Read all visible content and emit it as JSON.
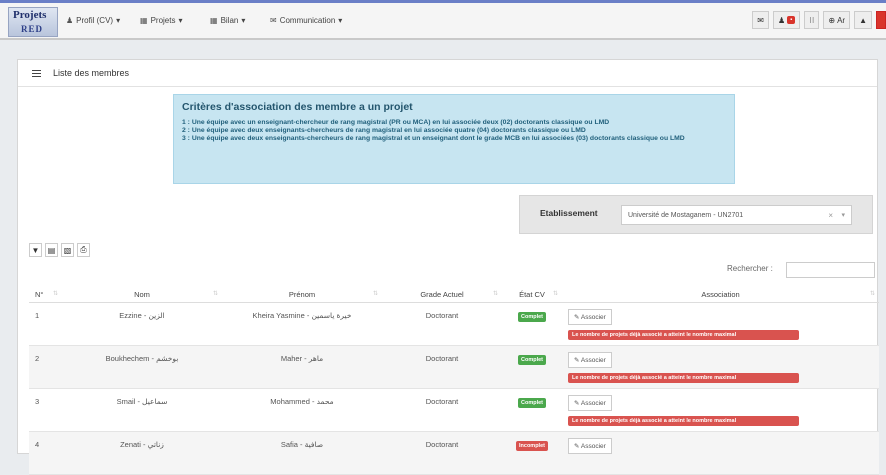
{
  "app": {
    "logo_line1": "Projets",
    "logo_line2": "RED"
  },
  "nav": [
    {
      "icon": "user-icon",
      "glyph": "♟",
      "label": "Profil (CV)",
      "caret": "▾"
    },
    {
      "icon": "table-icon",
      "glyph": "▦",
      "label": "Projets",
      "caret": "▾"
    },
    {
      "icon": "table-icon",
      "glyph": "▦",
      "label": "Bilan",
      "caret": "▾"
    },
    {
      "icon": "chat-icon",
      "glyph": "✉",
      "label": "Communication",
      "caret": "▾"
    }
  ],
  "top_right": {
    "lang": "Ar"
  },
  "panel": {
    "title": "Liste des membres"
  },
  "criteria": {
    "title": "Critères d'association des membre a un projet",
    "lines": [
      "1 : Une équipe avec un enseignant-chercheur de rang magistral (PR ou MCA) en lui associée deux (02) doctorants classique ou LMD",
      "2 : Une équipe avec deux enseignants-chercheurs de rang magistral en lui associée quatre (04) doctorants classique ou LMD",
      "3 : Une équipe avec deux enseignants-chercheurs de rang magistral et un enseignant dont le grade MCB en lui associées (03) doctorants classique ou LMD"
    ]
  },
  "etablissement": {
    "label": "Etablissement",
    "value": "Université de Mostaganem - UN2701"
  },
  "search": {
    "label": "Rechercher :"
  },
  "table": {
    "headers": [
      "N°",
      "Nom",
      "Prénom",
      "Grade Actuel",
      "État CV",
      "Association"
    ],
    "rows": [
      {
        "num": "1",
        "nom": "Ezzine - الزين",
        "prenom": "Kheira Yasmine - خيرة ياسمين",
        "grade": "Doctorant",
        "cv": "Complet",
        "cv_status": "ok",
        "btn": "✎ Associer",
        "warn": "Le nombre de projets déjà associé a atteint le nombre maximal"
      },
      {
        "num": "2",
        "nom": "Boukhechem - بوخشم",
        "prenom": "Maher - ماهر",
        "grade": "Doctorant",
        "cv": "Complet",
        "cv_status": "ok",
        "btn": "✎ Associer",
        "warn": "Le nombre de projets déjà associé a atteint le nombre maximal"
      },
      {
        "num": "3",
        "nom": "Smail - سماعيل",
        "prenom": "Mohammed - محمد",
        "grade": "Doctorant",
        "cv": "Complet",
        "cv_status": "ok",
        "btn": "✎ Associer",
        "warn": "Le nombre de projets déjà associé a atteint le nombre maximal"
      },
      {
        "num": "4",
        "nom": "Zenati - زناتي",
        "prenom": "Safia - صافية",
        "grade": "Doctorant",
        "cv": "Incomplet",
        "cv_status": "ko",
        "btn": "✎ Associer",
        "warn": ""
      }
    ]
  },
  "colors": {
    "accent": "#6a7fc7",
    "complete": "#4ba84c",
    "incomplete": "#d9534f",
    "criteria_bg": "#c7e5f1"
  }
}
